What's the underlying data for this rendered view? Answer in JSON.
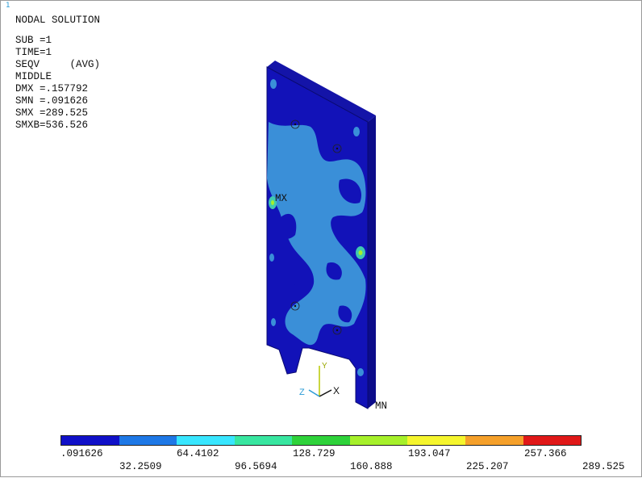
{
  "window_number": "1",
  "info": {
    "title": "NODAL SOLUTION",
    "lines": [
      "SUB =1",
      "TIME=1",
      "SEQV     (AVG)",
      "MIDDLE",
      "DMX =.157792",
      "SMN =.091626",
      "SMX =289.525",
      "SMXB=536.526"
    ]
  },
  "markers": {
    "max": "MX",
    "min": "MN"
  },
  "triad": {
    "x": "X",
    "y": "Y",
    "z": "Z"
  },
  "legend": {
    "colors": [
      "#1010c8",
      "#1e78e6",
      "#38e6ff",
      "#38e6a0",
      "#2ed23a",
      "#a6f02a",
      "#f5f52d",
      "#f5a02a",
      "#e01818"
    ],
    "labels": [
      ".091626",
      "32.2509",
      "64.4102",
      "96.5694",
      "128.729",
      "160.888",
      "193.047",
      "225.207",
      "257.366",
      "289.525"
    ]
  }
}
